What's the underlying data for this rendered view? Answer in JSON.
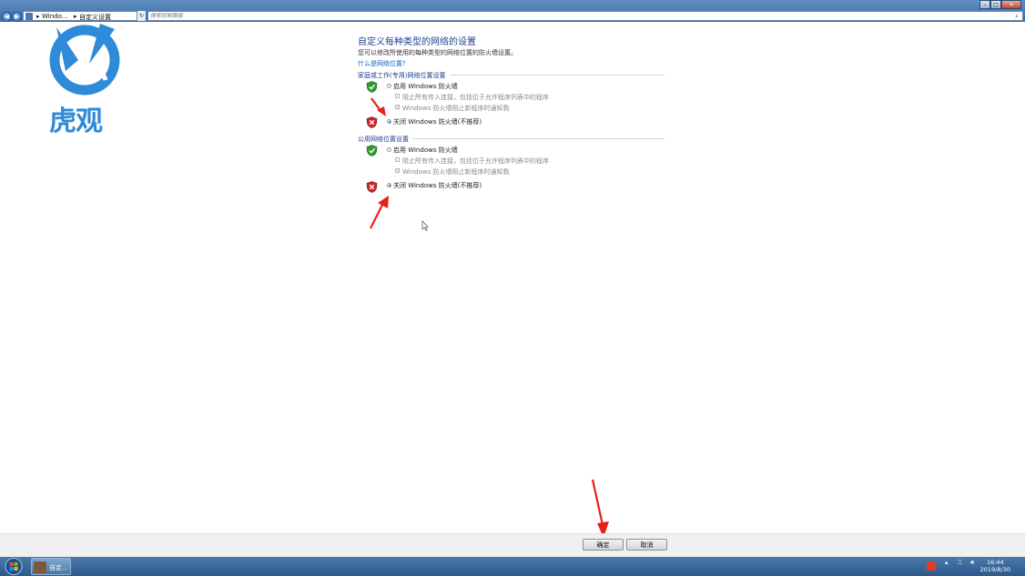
{
  "window": {
    "address": {
      "crumb1": "Windo...",
      "crumb2": "自定义设置"
    },
    "search": {
      "placeholder": "搜索控制面板"
    }
  },
  "logo": {
    "text": "虎观"
  },
  "main": {
    "heading": "自定义每种类型的网络的设置",
    "description": "您可以修改所使用的每种类型的网络位置的防火墙设置。",
    "link": "什么是网络位置?",
    "sections": [
      {
        "title": "家庭或工作(专用)网络位置设置",
        "enable_label": "启用 Windows 防火墙",
        "block_all_label": "阻止所有传入连接，包括位于允许程序列表中的程序",
        "notify_label": "Windows 防火墙阻止新程序时通知我",
        "disable_label": "关闭 Windows 防火墙(不推荐)",
        "selected": "disable"
      },
      {
        "title": "公用网络位置设置",
        "enable_label": "启用 Windows 防火墙",
        "block_all_label": "阻止所有传入连接，包括位于允许程序列表中的程序",
        "notify_label": "Windows 防火墙阻止新程序时通知我",
        "disable_label": "关闭 Windows 防火墙(不推荐)",
        "selected": "disable"
      }
    ]
  },
  "buttons": {
    "ok": "确定",
    "cancel": "取消"
  },
  "taskbar": {
    "task_label": "自定...",
    "time": "16:44",
    "date": "2019/8/30"
  },
  "colors": {
    "accent": "#1f3f8f",
    "link": "#1565c8",
    "arrow": "#e8201a"
  }
}
